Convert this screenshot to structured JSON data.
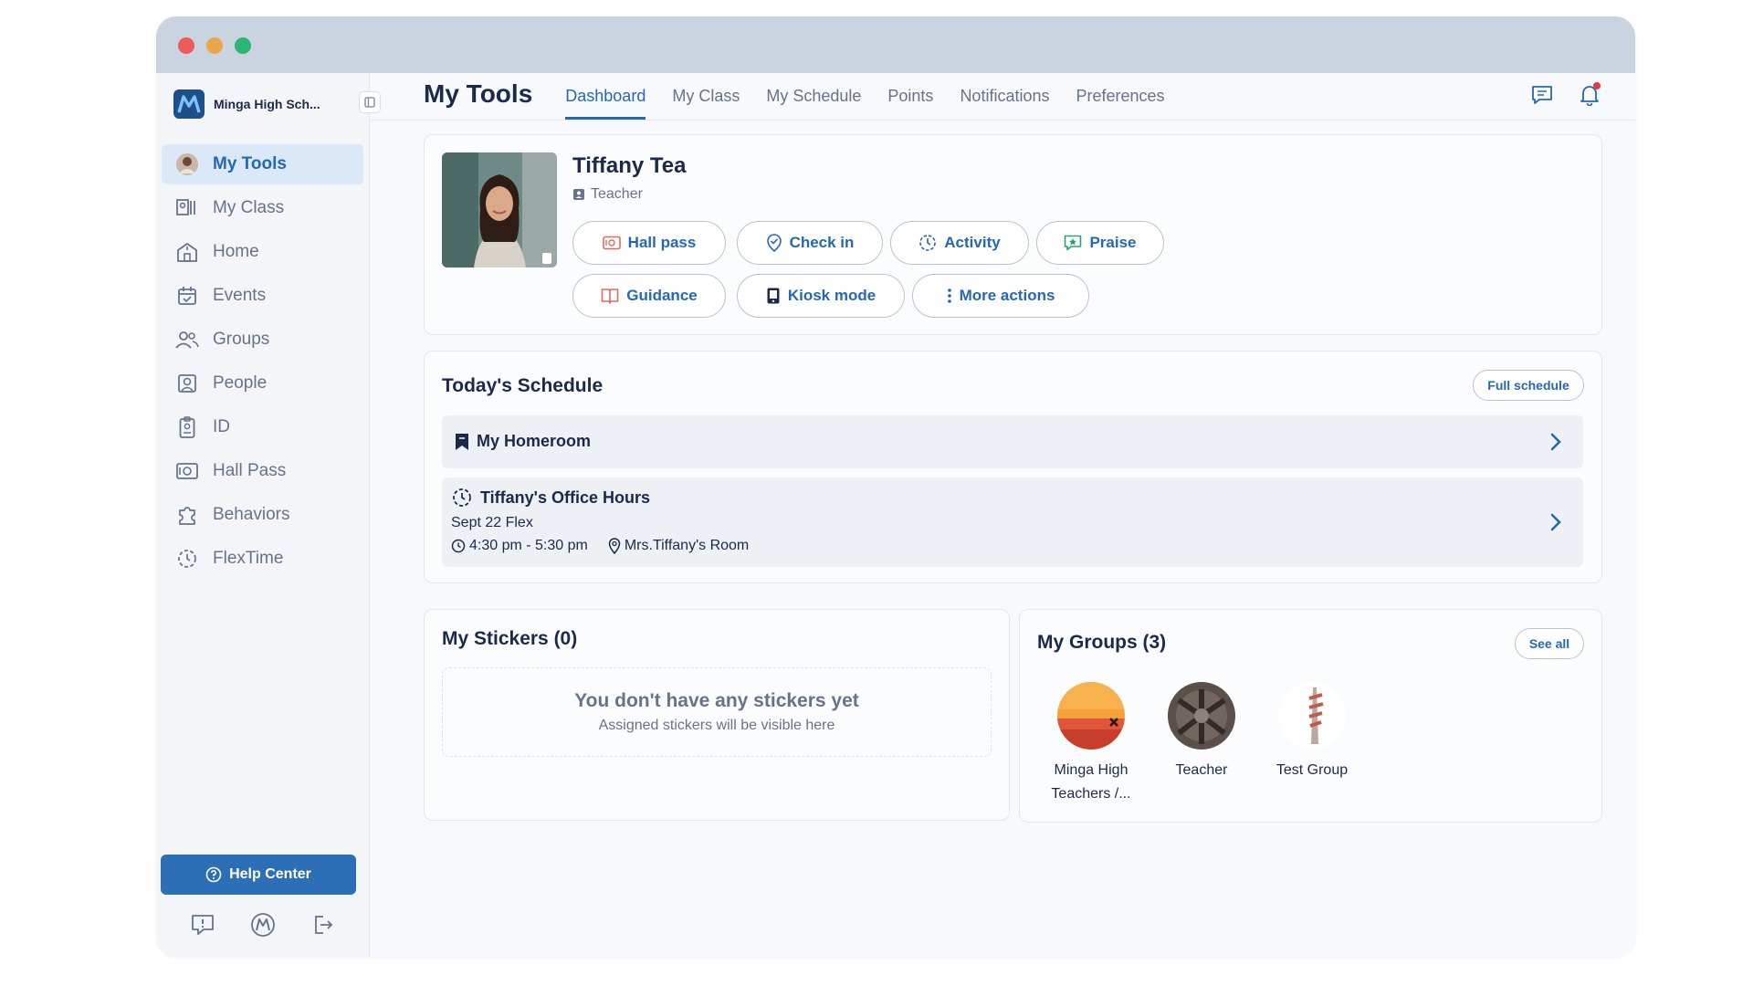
{
  "sidebar": {
    "brand": "Minga High Sch...",
    "items": [
      {
        "label": "My Tools"
      },
      {
        "label": "My Class"
      },
      {
        "label": "Home"
      },
      {
        "label": "Events"
      },
      {
        "label": "Groups"
      },
      {
        "label": "People"
      },
      {
        "label": "ID"
      },
      {
        "label": "Hall Pass"
      },
      {
        "label": "Behaviors"
      },
      {
        "label": "FlexTime"
      }
    ],
    "help_label": "Help Center"
  },
  "header": {
    "title": "My Tools",
    "tabs": [
      {
        "label": "Dashboard"
      },
      {
        "label": "My Class"
      },
      {
        "label": "My Schedule"
      },
      {
        "label": "Points"
      },
      {
        "label": "Notifications"
      },
      {
        "label": "Preferences"
      }
    ]
  },
  "profile": {
    "name": "Tiffany Tea",
    "role": "Teacher",
    "actions": [
      {
        "label": "Hall pass"
      },
      {
        "label": "Check in"
      },
      {
        "label": "Activity"
      },
      {
        "label": "Praise"
      },
      {
        "label": "Guidance"
      },
      {
        "label": "Kiosk mode"
      },
      {
        "label": "More actions"
      }
    ]
  },
  "schedule": {
    "title": "Today's Schedule",
    "full_label": "Full schedule",
    "homeroom": "My Homeroom",
    "office": {
      "title": "Tiffany's Office Hours",
      "sub": "Sept 22 Flex",
      "time": "4:30 pm - 5:30 pm",
      "location": "Mrs.Tiffany's Room"
    }
  },
  "stickers": {
    "title": "My Stickers (0)",
    "empty_title": "You don't have any stickers yet",
    "empty_sub": "Assigned stickers will be visible here"
  },
  "groups": {
    "title": "My Groups (3)",
    "see_all": "See all",
    "items": [
      {
        "line1": "Minga High",
        "line2": "Teachers /..."
      },
      {
        "line1": "Teacher",
        "line2": ""
      },
      {
        "line1": "Test Group",
        "line2": ""
      }
    ]
  },
  "colors": {
    "accent": "#2468b3",
    "active_bg": "#dae8f8",
    "help_button": "#2c6fb6",
    "notification_dot": "#e63946"
  }
}
